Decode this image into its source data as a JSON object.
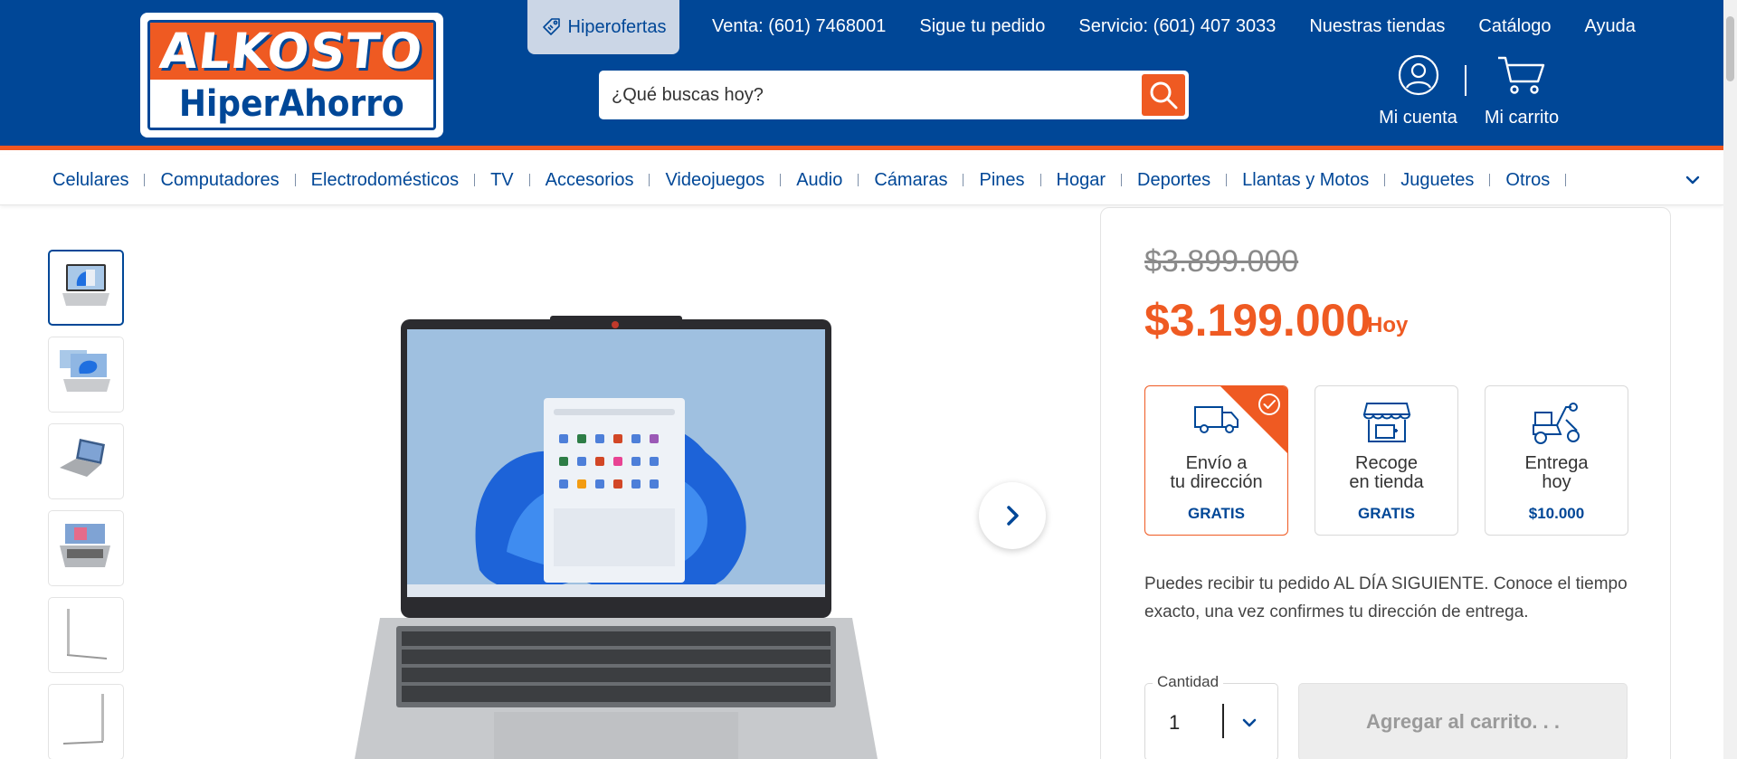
{
  "header": {
    "logo_top": "ALKOSTO",
    "logo_bottom": "HiperAhorro",
    "hiperofertas": "Hiperofertas",
    "top_links": [
      "Venta: (601) 7468001",
      "Sigue tu pedido",
      "Servicio: (601) 407 3033",
      "Nuestras tiendas",
      "Catálogo",
      "Ayuda"
    ],
    "search_placeholder": "¿Qué buscas hoy?",
    "account_label": "Mi cuenta",
    "cart_label": "Mi carrito"
  },
  "categories": [
    "Celulares",
    "Computadores",
    "Electrodomésticos",
    "TV",
    "Accesorios",
    "Videojuegos",
    "Audio",
    "Cámaras",
    "Pines",
    "Hogar",
    "Deportes",
    "Llantas y Motos",
    "Juguetes",
    "Otros"
  ],
  "product": {
    "old_price": "$3.899.000",
    "price": "$3.199.000",
    "price_suffix": "Hoy",
    "delivery_options": [
      {
        "line1": "Envío a",
        "line2": "tu dirección",
        "price": "GRATIS",
        "icon": "truck-icon",
        "selected": true
      },
      {
        "line1": "Recoge",
        "line2": "en tienda",
        "price": "GRATIS",
        "icon": "store-icon",
        "selected": false
      },
      {
        "line1": "Entrega",
        "line2": "hoy",
        "price": "$10.000",
        "icon": "scooter-icon",
        "selected": false
      }
    ],
    "delivery_info": "Puedes recibir tu pedido AL DÍA SIGUIENTE. Conoce el tiempo exacto, una vez confirmes tu dirección de entrega.",
    "quantity_label": "Cantidad",
    "quantity": "1",
    "add_to_cart": "Agregar al carrito. . ."
  },
  "colors": {
    "brand_blue": "#004797",
    "accent_orange": "#ef5a22"
  }
}
